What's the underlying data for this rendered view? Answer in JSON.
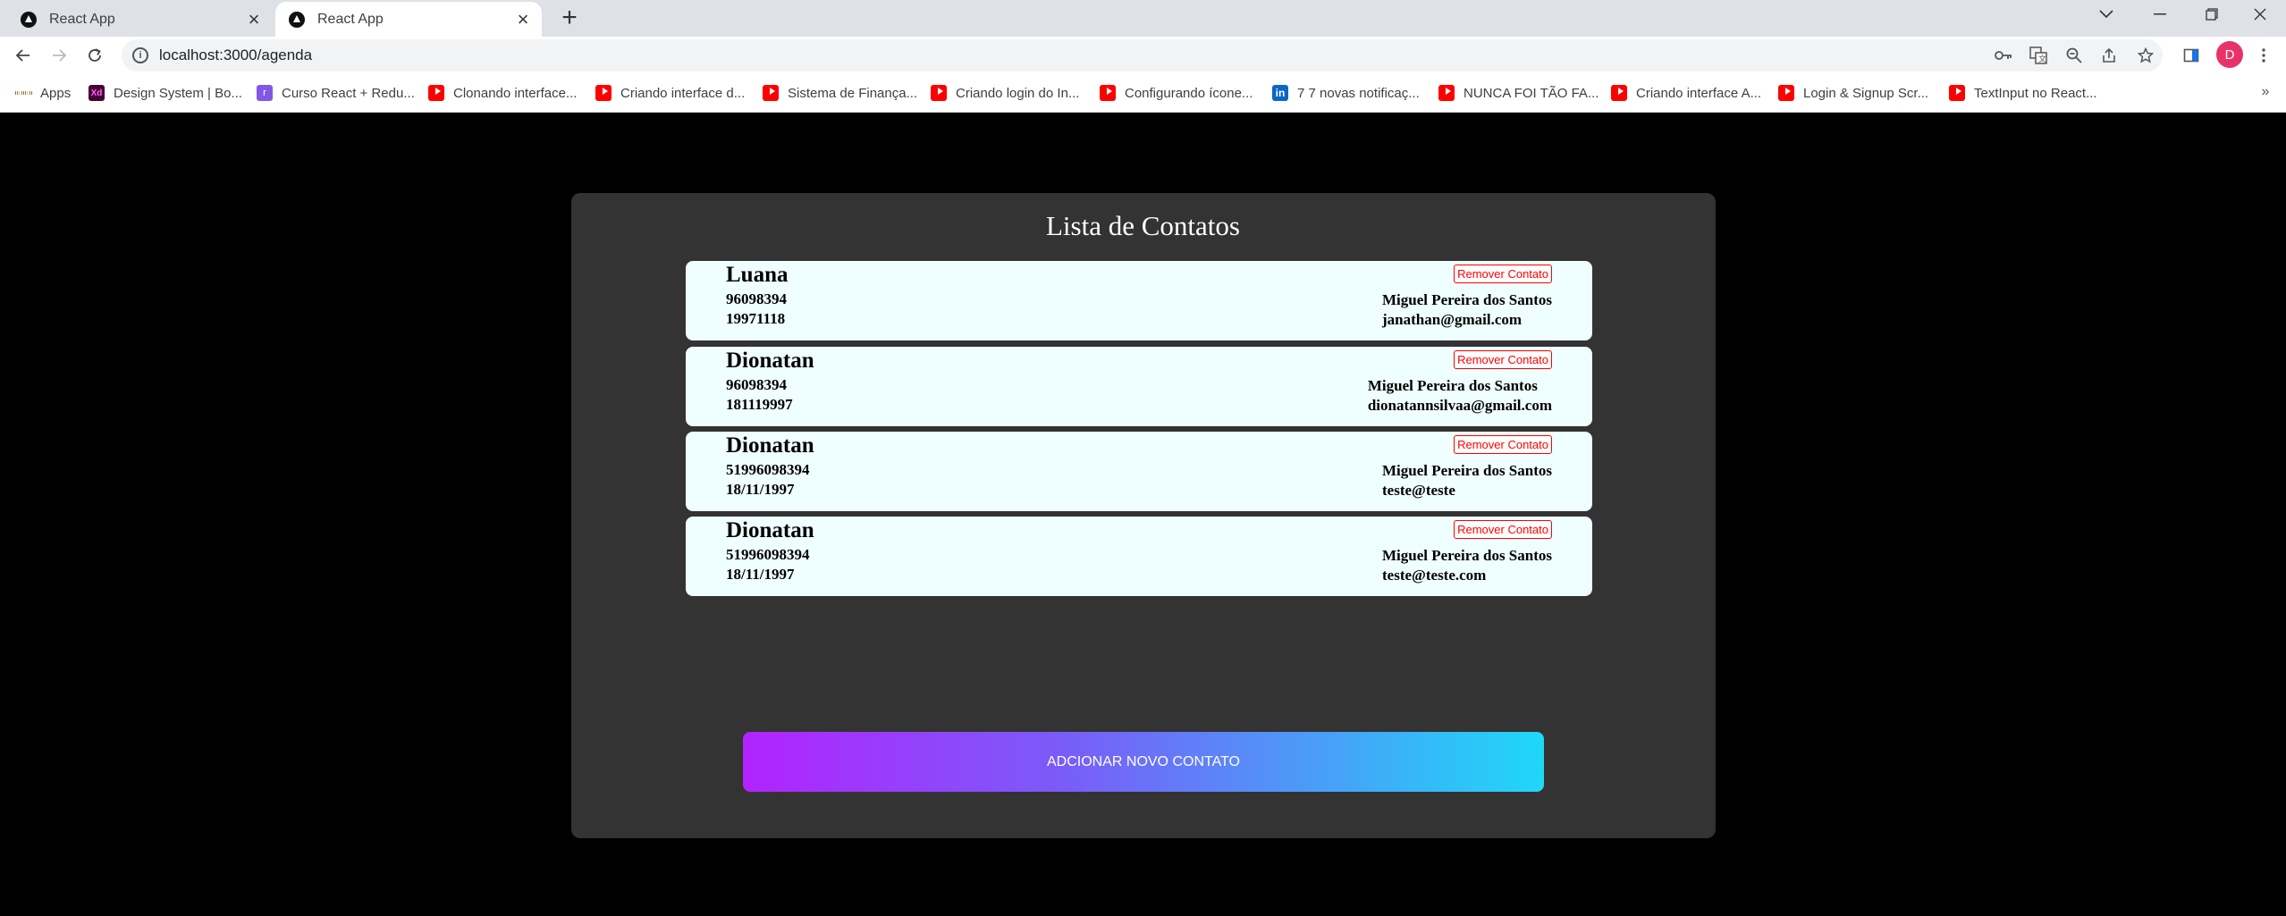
{
  "browser": {
    "tabs": [
      {
        "title": "React App",
        "active": false
      },
      {
        "title": "React App",
        "active": true
      }
    ],
    "new_tab_glyph": "+",
    "url": "localhost:3000/agenda",
    "profile_initial": "D",
    "bookmarks": [
      {
        "label": "Apps",
        "icon": "apps-icon"
      },
      {
        "label": "Design System | Bo...",
        "icon": "adobe-xd-icon"
      },
      {
        "label": "Curso React + Redu...",
        "icon": "rocketseat-icon"
      },
      {
        "label": "Clonando interface...",
        "icon": "youtube-icon"
      },
      {
        "label": "Criando interface d...",
        "icon": "youtube-icon"
      },
      {
        "label": "Sistema de Finança...",
        "icon": "youtube-icon"
      },
      {
        "label": "Criando login do In...",
        "icon": "youtube-icon"
      },
      {
        "label": "Configurando ícone...",
        "icon": "youtube-icon"
      },
      {
        "label": "7 7 novas notificaç...",
        "icon": "linkedin-icon"
      },
      {
        "label": "NUNCA FOI TÃO FA...",
        "icon": "youtube-icon"
      },
      {
        "label": "Criando interface A...",
        "icon": "youtube-icon"
      },
      {
        "label": "Login & Signup Scr...",
        "icon": "youtube-icon"
      },
      {
        "label": "TextInput no React...",
        "icon": "youtube-icon"
      }
    ]
  },
  "page": {
    "title": "Lista de Contatos",
    "remove_label": "Remover Contato",
    "add_button_label": "ADCIONAR NOVO CONTATO",
    "contacts": [
      {
        "name": "Luana",
        "phone": "96098394",
        "birth": "19971118",
        "address": "Miguel Pereira dos Santos",
        "email": "janathan@gmail.com"
      },
      {
        "name": "Dionatan",
        "phone": "96098394",
        "birth": "181119997",
        "address": "Miguel Pereira dos Santos",
        "email": "dionatannsilvaa@gmail.com"
      },
      {
        "name": "Dionatan",
        "phone": "51996098394",
        "birth": "18/11/1997",
        "address": "Miguel Pereira dos Santos",
        "email": "teste@teste"
      },
      {
        "name": "Dionatan",
        "phone": "51996098394",
        "birth": "18/11/1997",
        "address": "Miguel Pereira dos Santos",
        "email": "teste@teste.com"
      }
    ]
  },
  "colors": {
    "page_bg": "#000000",
    "panel_bg": "#333333",
    "card_bg": "#effefe",
    "remove_red": "#ff0000",
    "gradient_start": "#b223ff",
    "gradient_end": "#1fd8f8"
  }
}
